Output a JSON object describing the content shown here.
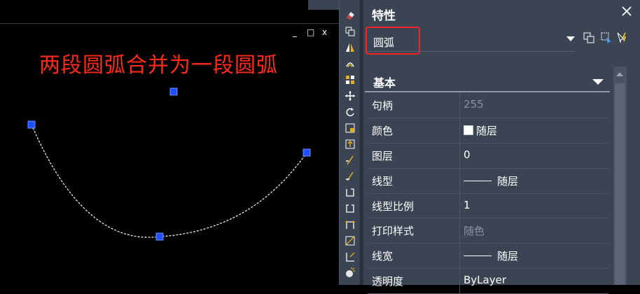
{
  "canvas": {
    "caption": "两段圆弧合并为一段圆弧",
    "window_controls": [
      "_",
      "□",
      "x"
    ]
  },
  "panel": {
    "title": "特性",
    "close_icon": "close-icon",
    "selector_value": "圆弧",
    "group_label": "基本",
    "rows": [
      {
        "name": "句柄",
        "value": "255",
        "dim": true
      },
      {
        "name": "颜色",
        "value": "随层",
        "swatch": true
      },
      {
        "name": "图层",
        "value": "0"
      },
      {
        "name": "线型",
        "value": "随层",
        "line": true
      },
      {
        "name": "线型比例",
        "value": "1"
      },
      {
        "name": "打印样式",
        "value": "随色",
        "dim": true
      },
      {
        "name": "线宽",
        "value": "随层",
        "line": true
      },
      {
        "name": "透明度",
        "value": "ByLayer"
      }
    ]
  },
  "toolbar": {
    "icons": [
      "eraser-icon",
      "copy-icon",
      "mirror-icon",
      "offset-icon",
      "array-icon",
      "move-icon",
      "rotate-icon",
      "scale-icon",
      "stretch-icon",
      "trim-icon",
      "extend-icon",
      "break-icon",
      "break-at-point-icon",
      "join-icon",
      "chamfer-icon",
      "fillet-icon",
      "explode-icon"
    ]
  },
  "colors": {
    "caption": "#ff2a1a",
    "grip": "#1f4fff",
    "panel_bg": "#3b4453",
    "highlight_box": "#ff2020"
  }
}
